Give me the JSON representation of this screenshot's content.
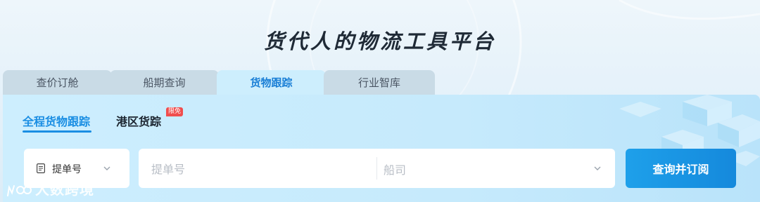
{
  "header": {
    "title": "货代人的物流工具平台"
  },
  "tabs": [
    {
      "label": "查价订舱",
      "active": false
    },
    {
      "label": "船期查询",
      "active": false
    },
    {
      "label": "货物跟踪",
      "active": true
    },
    {
      "label": "行业智库",
      "active": false
    }
  ],
  "subtabs": [
    {
      "label": "全程货物跟踪",
      "active": true
    },
    {
      "label": "港区货踪",
      "active": false,
      "badge": "限免"
    }
  ],
  "search": {
    "type_select": {
      "value": "提单号",
      "icon": "document-icon"
    },
    "query_placeholder": "提单号",
    "carrier_placeholder": "船司",
    "submit_label": "查询并订阅"
  },
  "watermark": {
    "text": "大数跨境"
  },
  "colors": {
    "accent": "#1a8ee3",
    "badge": "#f04d4d",
    "button": "#1589dc"
  }
}
